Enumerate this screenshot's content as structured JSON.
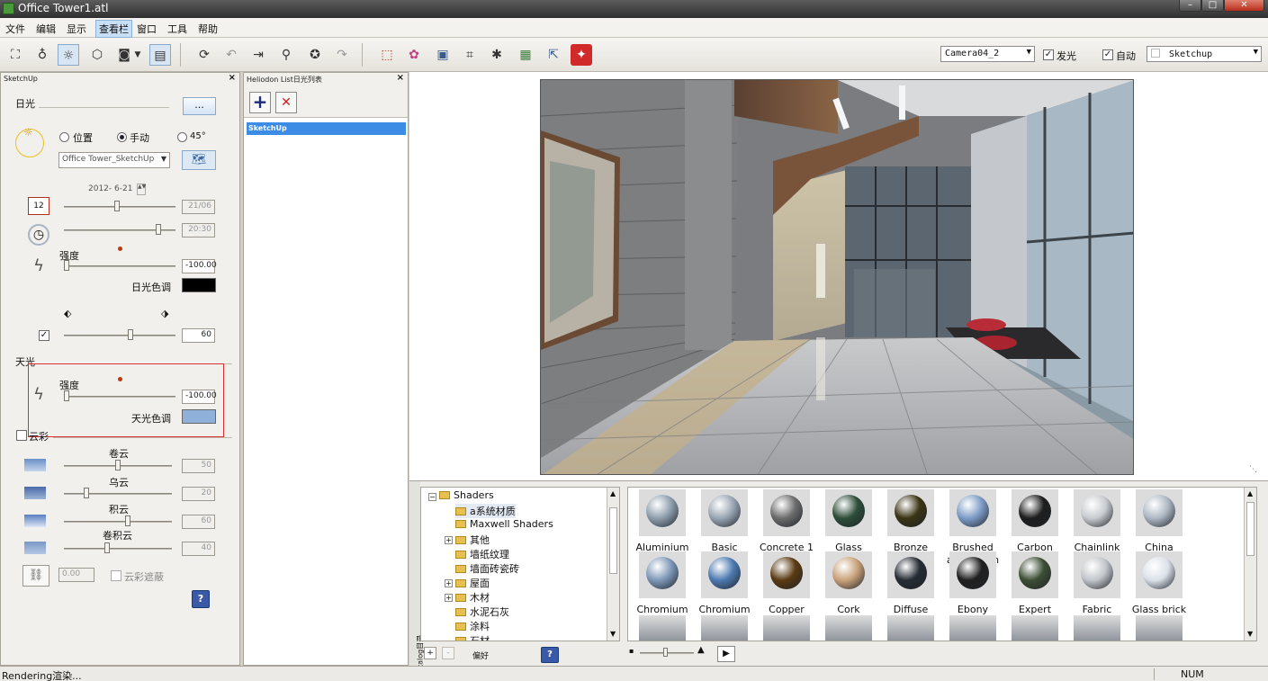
{
  "window": {
    "title": "Office Tower1.atl",
    "min": "–",
    "max": "□",
    "close": "✕"
  },
  "menu": [
    "文件",
    "编辑",
    "显示",
    "查看栏",
    "窗口",
    "工具",
    "帮助"
  ],
  "toolbar": {
    "camera": "Camera04_2",
    "glow_label": "发光",
    "glow_checked": true,
    "auto_label": "自动",
    "auto_checked": true,
    "preset": "Sketchup"
  },
  "sun_panel": {
    "title": "SketchUp",
    "sunlight_label": "日光",
    "more_button": "...",
    "radio_position": "位置",
    "radio_manual": "手动",
    "radio_45": "45°",
    "location": "Office Tower_SketchUp",
    "date": "2012- 6-21",
    "day_value": "21/06",
    "time_value": "20:30",
    "intensity_label": "强度",
    "intensity_value": "-100.00",
    "sun_color_label": "日光色调",
    "sun_color": "#000000",
    "shadow_value": "60",
    "sky_label": "天光",
    "sky_intensity_label": "强度",
    "sky_intensity_value": "-100.00",
    "sky_color_label": "天光色调",
    "sky_color": "#8fb0d8",
    "clouds_label": "云彩",
    "cirrus_label": "卷云",
    "cirrus_value": "50",
    "dark_cloud_label": "乌云",
    "dark_cloud_value": "20",
    "cumulus_label": "积云",
    "cumulus_value": "60",
    "cumulonimbus_label": "卷积云",
    "cumulonimbus_value": "40",
    "offset_value": "0.00",
    "cloud_shadow_label": "云彩遮蔽"
  },
  "heliodon_panel": {
    "title": "Heliodon List日光列表",
    "add": "+",
    "remove": "✕",
    "items": [
      "SketchUp"
    ]
  },
  "catalog": {
    "side_label": "Catalog目录",
    "tree": [
      "Shaders",
      "a系统材质",
      "Maxwell Shaders",
      "其他",
      "墙纸纹理",
      "墙面砖瓷砖",
      "屋面",
      "木材",
      "水泥石灰",
      "涂料",
      "石材"
    ],
    "tree_footer": "偏好",
    "materials": [
      {
        "name": "Aluminium",
        "color": "#8e9fae"
      },
      {
        "name": "Basic",
        "color": "#9aa6b4"
      },
      {
        "name": "Concrete 1",
        "color": "#6c6c6c"
      },
      {
        "name": "Glass bottle",
        "color": "#2e4e3a"
      },
      {
        "name": "Bronze",
        "color": "#3a3414"
      },
      {
        "name": "Brushed aluminium",
        "color": "#7d9cc6"
      },
      {
        "name": "Carbon",
        "color": "#1e1e1e"
      },
      {
        "name": "Chainlink fencing",
        "color": "#c8ccd0"
      },
      {
        "name": "China",
        "color": "#aeb8c4"
      },
      {
        "name": "Chromium",
        "color": "#7d98b8"
      },
      {
        "name": "Chromium",
        "color": "#4d7ab0"
      },
      {
        "name": "Copper",
        "color": "#5a3a12"
      },
      {
        "name": "Cork",
        "color": "#c9a27a"
      },
      {
        "name": "Diffuse Fresnel",
        "color": "#262c34"
      },
      {
        "name": "Ebony",
        "color": "#202020"
      },
      {
        "name": "Expert",
        "color": "#3c4e34"
      },
      {
        "name": "Fabric",
        "color": "#c2c6ca"
      },
      {
        "name": "Glass brick",
        "color": "#dce2ea"
      }
    ]
  },
  "status": {
    "left": "Rendering渲染...",
    "right": "NUM"
  }
}
